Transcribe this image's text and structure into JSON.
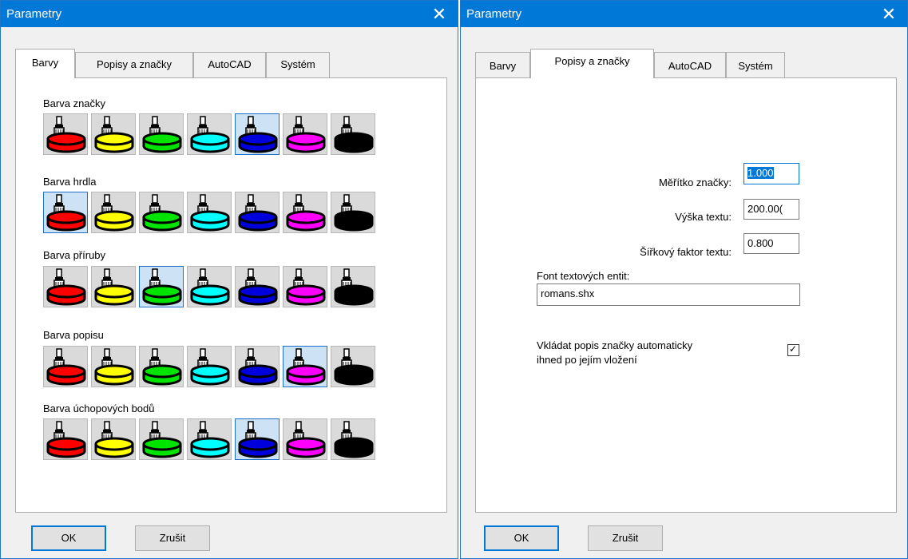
{
  "dialogs": [
    {
      "title": "Parametry",
      "tabs": [
        "Barvy",
        "Popisy a značky",
        "AutoCAD",
        "Systém"
      ],
      "selected_tab": "Barvy",
      "groups": [
        {
          "label": "Barva značky",
          "selected_index": 4
        },
        {
          "label": "Barva hrdla",
          "selected_index": 0
        },
        {
          "label": "Barva příruby",
          "selected_index": 2
        },
        {
          "label": "Barva popisu",
          "selected_index": 5
        },
        {
          "label": "Barva úchopových bodů",
          "selected_index": 4
        }
      ],
      "swatch_colors": [
        {
          "name": "red",
          "hex": "#ff0000"
        },
        {
          "name": "yellow",
          "hex": "#ffff00"
        },
        {
          "name": "green",
          "hex": "#00e400"
        },
        {
          "name": "cyan",
          "hex": "#00ffff"
        },
        {
          "name": "blue",
          "hex": "#0000dc"
        },
        {
          "name": "magenta",
          "hex": "#ff00ff"
        },
        {
          "name": "black",
          "hex": "#000000"
        }
      ],
      "ok_label": "OK",
      "cancel_label": "Zrušit"
    },
    {
      "title": "Parametry",
      "tabs": [
        "Barvy",
        "Popisy a značky",
        "AutoCAD",
        "Systém"
      ],
      "selected_tab": "Popisy a značky",
      "fields": {
        "marker_scale_label": "Měřítko značky:",
        "marker_scale_value": "1.000",
        "text_height_label": "Výška textu:",
        "text_height_value": "200.00(",
        "text_width_label": "Šířkový faktor textu:",
        "text_width_value": "0.800",
        "font_label": "Font textových entit:",
        "font_value": "romans.shx",
        "auto_label_line1": "Vkládat popis značky automaticky",
        "auto_label_line2": "ihned po jejím vložení",
        "auto_label_checked": true,
        "check_mark": "✓"
      },
      "ok_label": "OK",
      "cancel_label": "Zrušit"
    }
  ],
  "close_glyph": "✕",
  "colors": {
    "titlebar": "#0078d7",
    "selection": "#cde2f5",
    "selection_border": "#1d6fc8"
  }
}
